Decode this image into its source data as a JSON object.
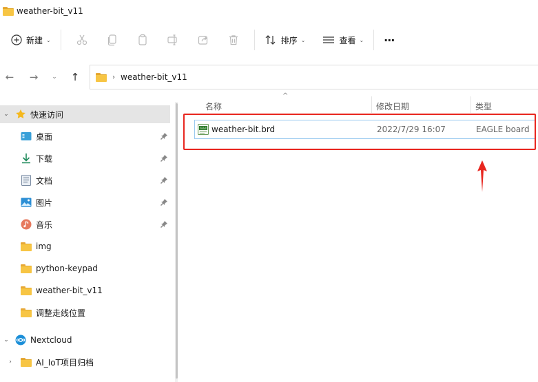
{
  "window": {
    "title": "weather-bit_v11"
  },
  "toolbar": {
    "new_label": "新建",
    "sort_label": "排序",
    "view_label": "查看",
    "more": "···"
  },
  "address": {
    "path": [
      "weather-bit_v11"
    ]
  },
  "sidebar": {
    "quick_access": "快速访问",
    "items": [
      {
        "label": "桌面",
        "icon": "desktop-icon",
        "pinned": true
      },
      {
        "label": "下载",
        "icon": "download-icon",
        "pinned": true
      },
      {
        "label": "文档",
        "icon": "document-icon",
        "pinned": true
      },
      {
        "label": "图片",
        "icon": "picture-icon",
        "pinned": true
      },
      {
        "label": "音乐",
        "icon": "music-icon",
        "pinned": true
      },
      {
        "label": "img",
        "icon": "folder-icon",
        "pinned": false
      },
      {
        "label": "python-keypad",
        "icon": "folder-icon",
        "pinned": false
      },
      {
        "label": "weather-bit_v11",
        "icon": "folder-icon",
        "pinned": false
      },
      {
        "label": "调整走线位置",
        "icon": "folder-icon",
        "pinned": false
      }
    ],
    "nextcloud": "Nextcloud",
    "nextcloud_items": [
      {
        "label": "AI_IoT项目归档",
        "icon": "folder-icon"
      }
    ]
  },
  "filelist": {
    "columns": [
      "名称",
      "修改日期",
      "类型"
    ],
    "files": [
      {
        "name": "weather-bit.brd",
        "modified": "2022/7/29 16:07",
        "type": "EAGLE board",
        "icon": "brd-file-icon"
      }
    ]
  },
  "colors": {
    "highlight": "#e8261f",
    "folder": "#f7c544",
    "accent": "#0067c0"
  }
}
